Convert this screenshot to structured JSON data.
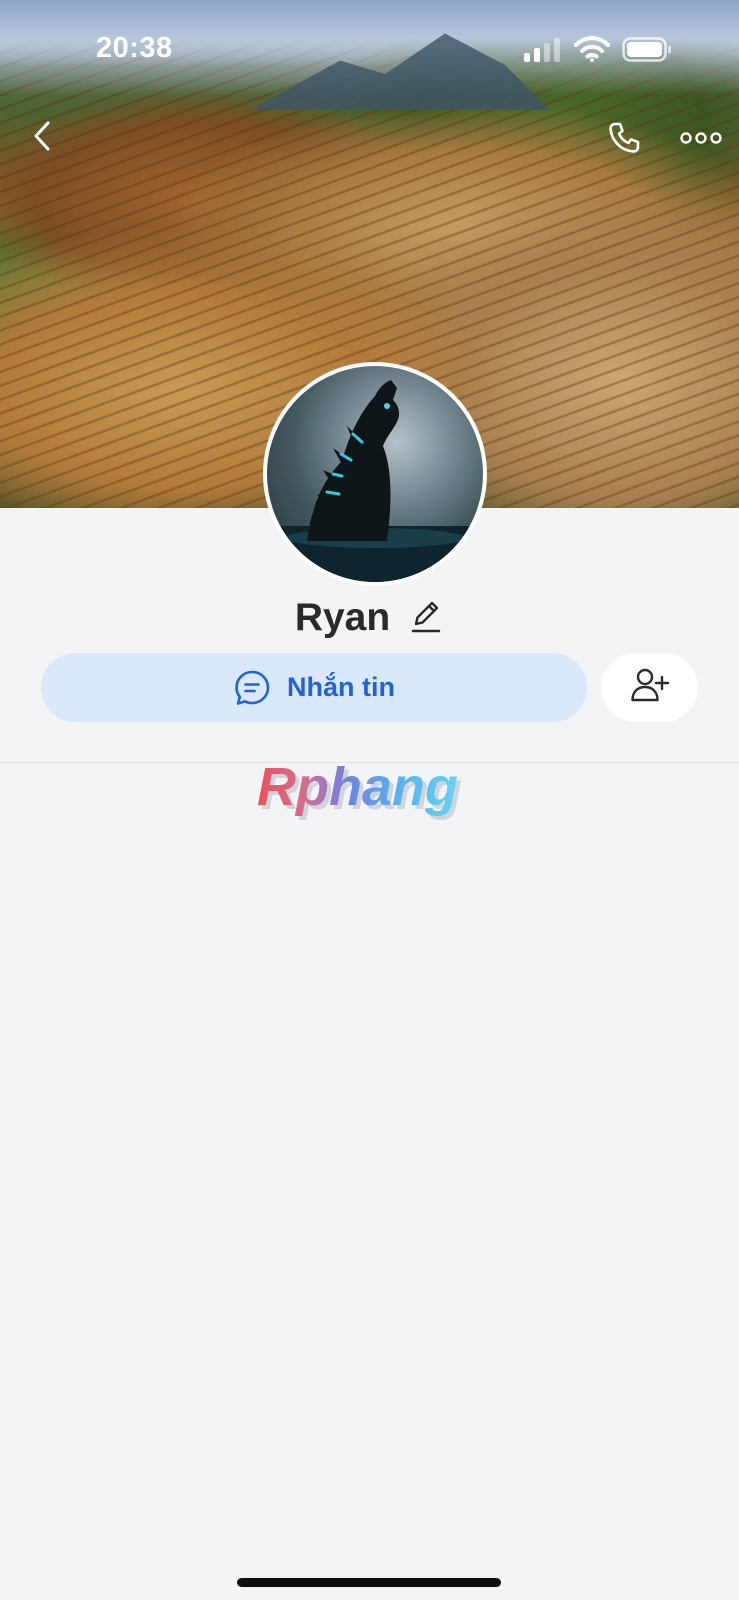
{
  "status_bar": {
    "time": "20:38",
    "icons": [
      "signal-icon",
      "wifi-icon",
      "battery-icon"
    ]
  },
  "header": {
    "back_icon": "chevron-left-icon",
    "call_icon": "phone-icon",
    "more_icon": "more-horizontal-icon"
  },
  "profile": {
    "name": "Ryan",
    "edit_icon": "pencil-icon",
    "avatar_icon": "avatar-image"
  },
  "actions": {
    "message_label": "Nhắn tin",
    "message_icon": "chat-bubble-icon",
    "add_friend_icon": "add-user-icon"
  },
  "watermark": {
    "text": "Rphang"
  },
  "colors": {
    "background": "#f3f4f6",
    "accent": "#1f63d8",
    "message_button_bg": "#dae8fc",
    "name_text": "#2a2a2a",
    "white": "#ffffff"
  }
}
